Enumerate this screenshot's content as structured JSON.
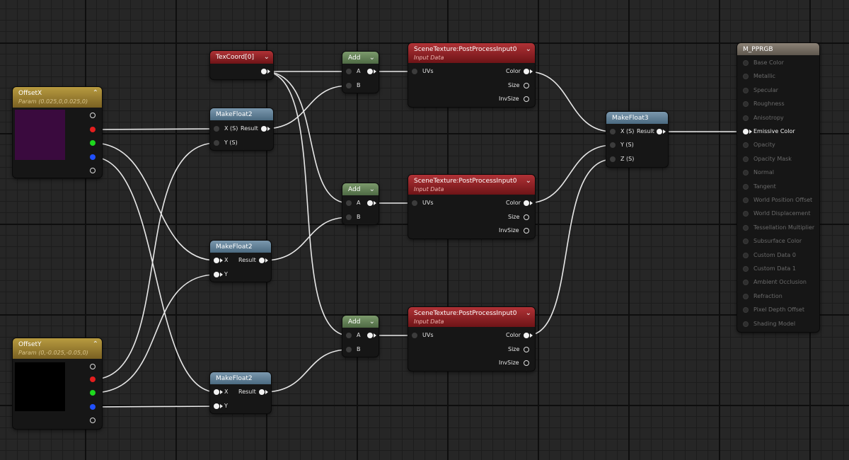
{
  "nodes": {
    "texcoord": {
      "title": "TexCoord[0]"
    },
    "add1": {
      "title": "Add",
      "inputs": [
        "A",
        "B"
      ]
    },
    "add2": {
      "title": "Add",
      "inputs": [
        "A",
        "B"
      ]
    },
    "add3": {
      "title": "Add",
      "inputs": [
        "A",
        "B"
      ]
    },
    "scene1": {
      "title": "SceneTexture:PostProcessInput0",
      "subtitle": "Input Data",
      "input": "UVs",
      "outputs": [
        "Color",
        "Size",
        "InvSize"
      ]
    },
    "scene2": {
      "title": "SceneTexture:PostProcessInput0",
      "subtitle": "Input Data",
      "input": "UVs",
      "outputs": [
        "Color",
        "Size",
        "InvSize"
      ]
    },
    "scene3": {
      "title": "SceneTexture:PostProcessInput0",
      "subtitle": "Input Data",
      "input": "UVs",
      "outputs": [
        "Color",
        "Size",
        "InvSize"
      ]
    },
    "offsetx": {
      "title": "OffsetX",
      "subtitle": "Param (0.025,0,0.025,0)",
      "swatch_color": "#3a0a3e"
    },
    "offsety": {
      "title": "OffsetY",
      "subtitle": "Param (0,-0.025,-0.05,0)",
      "swatch_color": "#000000"
    },
    "mf2a": {
      "title": "MakeFloat2",
      "inputs": [
        "X (S)",
        "Y (S)"
      ],
      "output": "Result"
    },
    "mf2b": {
      "title": "MakeFloat2",
      "inputs": [
        "X",
        "Y"
      ],
      "output": "Result"
    },
    "mf2c": {
      "title": "MakeFloat2",
      "inputs": [
        "X",
        "Y"
      ],
      "output": "Result"
    },
    "mf3": {
      "title": "MakeFloat3",
      "inputs": [
        "X (S)",
        "Y (S)",
        "Z (S)"
      ],
      "output": "Result"
    },
    "material": {
      "title": "M_PPRGB",
      "pins": [
        "Base Color",
        "Metallic",
        "Specular",
        "Roughness",
        "Anisotropy",
        "Emissive Color",
        "Opacity",
        "Opacity Mask",
        "Normal",
        "Tangent",
        "World Position Offset",
        "World Displacement",
        "Tessellation Multiplier",
        "Subsurface Color",
        "Custom Data 0",
        "Custom Data 1",
        "Ambient Occlusion",
        "Refraction",
        "Pixel Depth Offset",
        "Shading Model"
      ],
      "active_pin": "Emissive Color"
    }
  },
  "colors": {
    "wire": "#e8e8e8",
    "red_channel": "#e31e1e",
    "green_channel": "#1ed81e",
    "blue_channel": "#2050ff"
  },
  "icons": {
    "collapse": "chevron-down-icon",
    "expand": "chevron-up-icon"
  }
}
